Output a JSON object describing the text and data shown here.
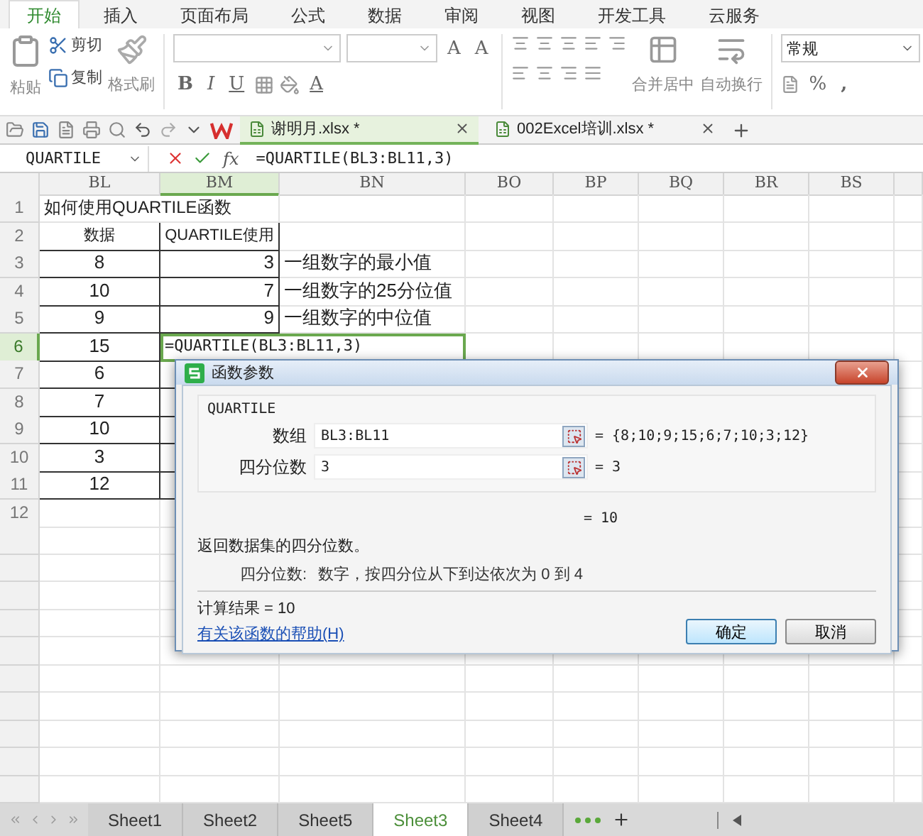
{
  "menu_tabs": [
    {
      "label": "开始",
      "selected": true
    },
    {
      "label": "插入",
      "selected": false
    },
    {
      "label": "页面布局",
      "selected": false
    },
    {
      "label": "公式",
      "selected": false
    },
    {
      "label": "数据",
      "selected": false
    },
    {
      "label": "审阅",
      "selected": false
    },
    {
      "label": "视图",
      "selected": false
    },
    {
      "label": "开发工具",
      "selected": false
    },
    {
      "label": "云服务",
      "selected": false
    }
  ],
  "ribbon": {
    "paste": "粘贴",
    "cut": "剪切",
    "copy": "复制",
    "format_painter": "格式刷",
    "size_buttons": [
      "A",
      "A"
    ],
    "font_buttons": [
      "B",
      "I",
      "U"
    ],
    "font_color": "A",
    "merge": "合并居中",
    "wrap": "自动换行",
    "number_format": "常规",
    "percent": "%",
    "comma": ","
  },
  "doc_tabs": [
    {
      "label": "谢明月.xlsx *",
      "selected": true
    },
    {
      "label": "002Excel培训.xlsx *",
      "selected": false
    }
  ],
  "formula_bar": {
    "name_box": "QUARTILE",
    "fx": "fx",
    "formula": "=QUARTILE(BL3:BL11,3)"
  },
  "sheet": {
    "columns": [
      {
        "label": "BL",
        "selected": false
      },
      {
        "label": "BM",
        "selected": true
      },
      {
        "label": "BN",
        "selected": false
      },
      {
        "label": "BO",
        "selected": false
      },
      {
        "label": "BP",
        "selected": false
      },
      {
        "label": "BQ",
        "selected": false
      },
      {
        "label": "BR",
        "selected": false
      },
      {
        "label": "BS",
        "selected": false
      }
    ],
    "rows": [
      {
        "number": "1",
        "selected": false,
        "cells": [
          {
            "text": "如何使用QUARTILE函数",
            "kind": "title"
          }
        ]
      },
      {
        "number": "2",
        "selected": false,
        "cells": [
          {
            "text": "数据",
            "kind": "header"
          },
          {
            "text": "QUARTILE使用",
            "kind": "header"
          }
        ]
      },
      {
        "number": "3",
        "selected": false,
        "cells": [
          {
            "text": "8",
            "kind": "value"
          },
          {
            "text": "3",
            "kind": "result"
          },
          {
            "text": "一组数字的最小值",
            "kind": "note"
          }
        ]
      },
      {
        "number": "4",
        "selected": false,
        "cells": [
          {
            "text": "10",
            "kind": "value"
          },
          {
            "text": "7",
            "kind": "result"
          },
          {
            "text": "一组数字的25分位值",
            "kind": "note"
          }
        ]
      },
      {
        "number": "5",
        "selected": false,
        "cells": [
          {
            "text": "9",
            "kind": "value"
          },
          {
            "text": "9",
            "kind": "result"
          },
          {
            "text": "一组数字的中位值",
            "kind": "note"
          }
        ]
      },
      {
        "number": "6",
        "selected": true,
        "cells": [
          {
            "text": "15",
            "kind": "value"
          },
          {
            "text": "=QUARTILE(BL3:BL11,3)",
            "kind": "formula",
            "active": true
          }
        ]
      },
      {
        "number": "7",
        "selected": false,
        "cells": [
          {
            "text": "6",
            "kind": "value"
          }
        ]
      },
      {
        "number": "8",
        "selected": false,
        "cells": [
          {
            "text": "7",
            "kind": "value"
          }
        ]
      },
      {
        "number": "9",
        "selected": false,
        "cells": [
          {
            "text": "10",
            "kind": "value"
          }
        ]
      },
      {
        "number": "10",
        "selected": false,
        "cells": [
          {
            "text": "3",
            "kind": "value"
          }
        ]
      },
      {
        "number": "11",
        "selected": false,
        "cells": [
          {
            "text": "12",
            "kind": "value"
          }
        ]
      },
      {
        "number": "12",
        "selected": false,
        "cells": []
      }
    ]
  },
  "dialog": {
    "title": "函数参数",
    "function_name": "QUARTILE",
    "args": [
      {
        "label": "数组",
        "value": "BL3:BL11",
        "result": "= {8;10;9;15;6;7;10;3;12}"
      },
      {
        "label": "四分位数",
        "value": "3",
        "result": "= 3"
      }
    ],
    "formula_result": "= 10",
    "description": "返回数据集的四分位数。",
    "param_label": "四分位数:",
    "param_help": "数字，按四分位从下到达依次为 0 到 4",
    "calc_result": "计算结果 = 10",
    "help_link": "有关该函数的帮助(H)",
    "buttons": [
      {
        "label": "确定",
        "kind": "primary"
      },
      {
        "label": "取消",
        "kind": "default"
      }
    ]
  },
  "sheet_tabs": [
    {
      "label": "Sheet1",
      "selected": false
    },
    {
      "label": "Sheet2",
      "selected": false
    },
    {
      "label": "Sheet5",
      "selected": false
    },
    {
      "label": "Sheet3",
      "selected": true
    },
    {
      "label": "Sheet4",
      "selected": false
    }
  ]
}
